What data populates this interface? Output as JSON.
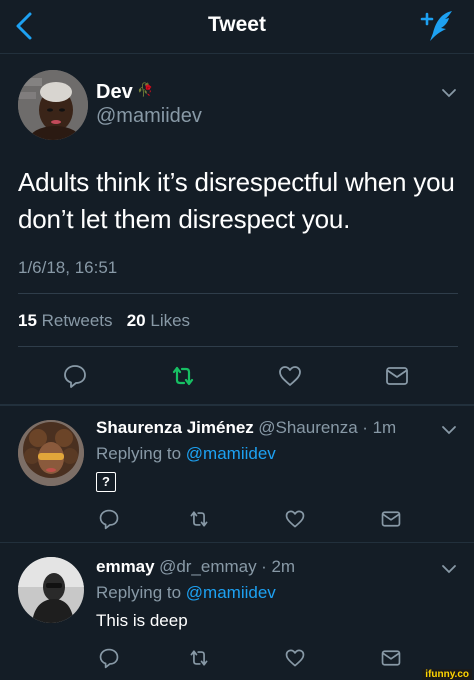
{
  "header": {
    "title": "Tweet"
  },
  "icons": {
    "back": "chevron-left-icon",
    "compose": "compose-tweet-icon",
    "more": "chevron-down-icon",
    "reply": "reply-icon",
    "retweet": "retweet-icon",
    "like": "heart-icon",
    "dm": "envelope-icon"
  },
  "colors": {
    "background": "#141d26",
    "accent": "#1da1f2",
    "retweet_active": "#17bf63",
    "muted": "#8899a6"
  },
  "tweet": {
    "author_name": "Dev",
    "author_emoji": "🥀",
    "author_handle": "@mamiidev",
    "text": "Adults think it’s disrespectful when you don’t let them disrespect you.",
    "timestamp": "1/6/18, 16:51",
    "retweets_count": "15",
    "retweets_label": "Retweets",
    "likes_count": "20",
    "likes_label": "Likes"
  },
  "replies": [
    {
      "name": "Shaurenza Jiménez",
      "handle": "@Shaurenza",
      "time": "· 1m",
      "replying_prefix": "Replying to",
      "replying_to": "@mamiidev",
      "body": "?"
    },
    {
      "name": "emmay",
      "handle": "@dr_emmay",
      "time": "· 2m",
      "replying_prefix": "Replying to",
      "replying_to": "@mamiidev",
      "body": "This is deep"
    }
  ],
  "watermark": "ifunny.co"
}
